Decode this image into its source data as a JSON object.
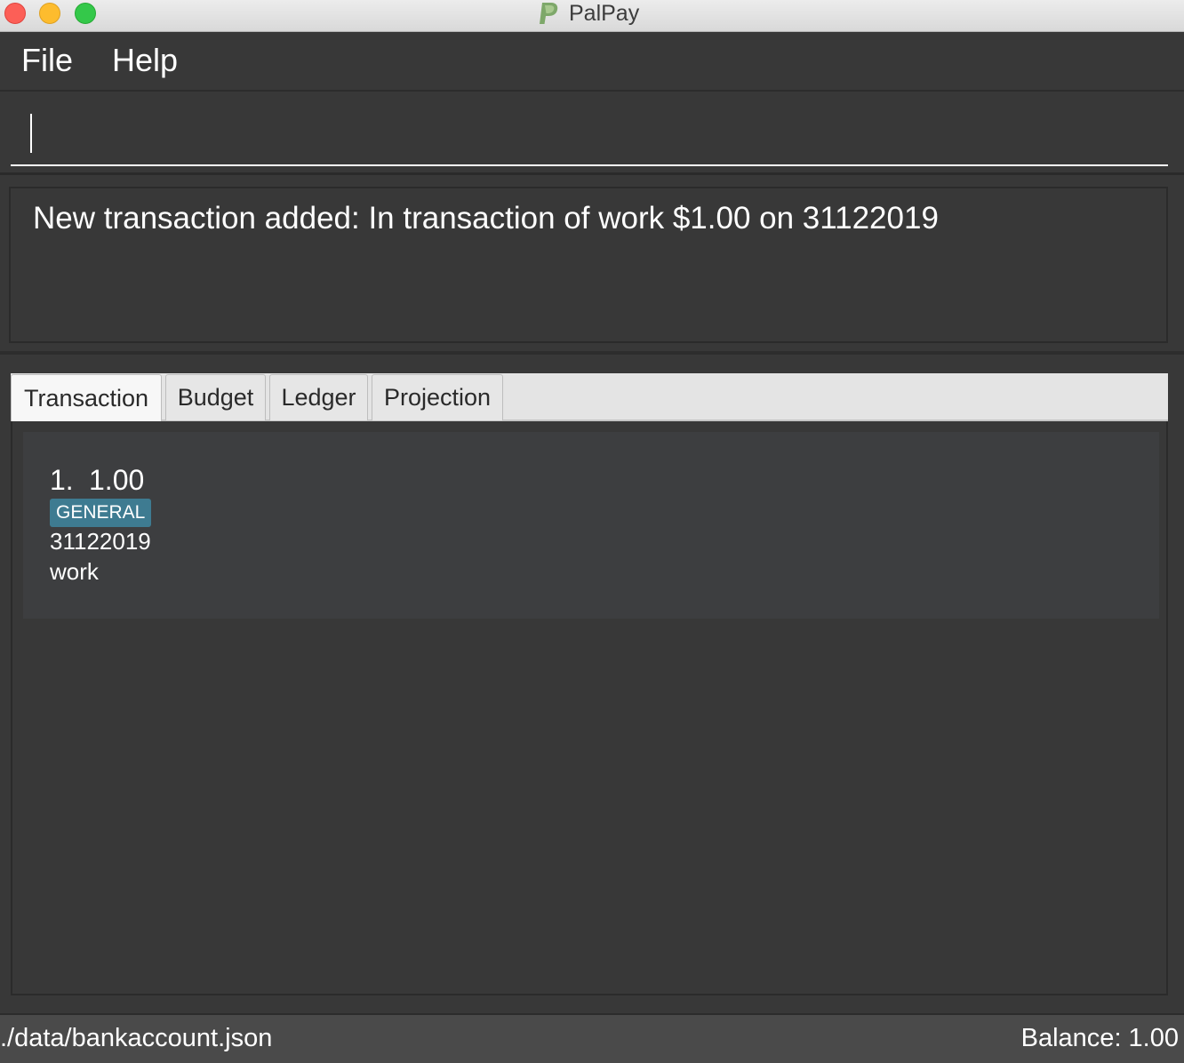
{
  "window": {
    "title": "PalPay",
    "logo_icon": "paypal-p-logo",
    "controls": [
      "close",
      "minimize",
      "maximize"
    ]
  },
  "menu": {
    "file_label": "File",
    "help_label": "Help"
  },
  "command_box": {
    "value": "",
    "placeholder": ""
  },
  "result_display": {
    "message": "New transaction added: In transaction of work $1.00 on 31122019"
  },
  "tabs": [
    {
      "label": "Transaction",
      "active": true
    },
    {
      "label": "Budget",
      "active": false
    },
    {
      "label": "Ledger",
      "active": false
    },
    {
      "label": "Projection",
      "active": false
    }
  ],
  "transactions": [
    {
      "index": "1.",
      "amount": "1.00",
      "category": "GENERAL",
      "date": "31122019",
      "description": "work"
    }
  ],
  "status_bar": {
    "file_path": "./data/bankaccount.json",
    "balance": "Balance: 1.00"
  },
  "colors": {
    "background": "#383838",
    "tag": "#3e7b91",
    "card": "#3d3e40",
    "status_bar": "#4a4a4a"
  }
}
